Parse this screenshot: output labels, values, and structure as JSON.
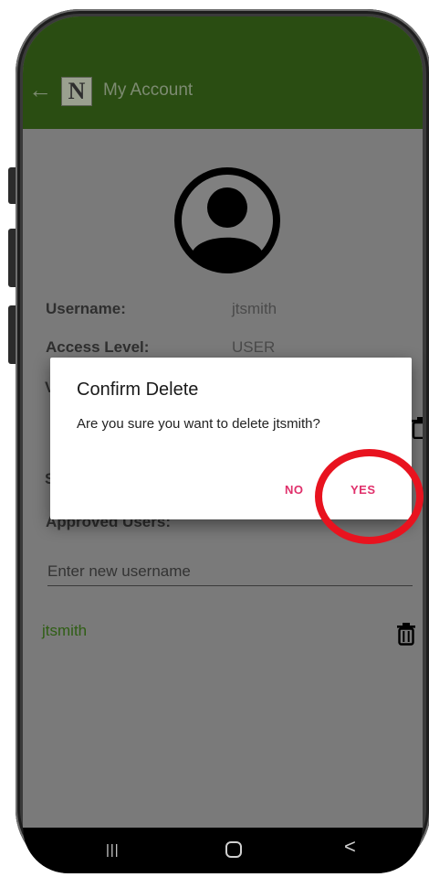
{
  "app_bar": {
    "back_icon": "back-arrow-icon",
    "logo_letter": "N",
    "title": "My Account",
    "color": "#2a4d12"
  },
  "profile": {
    "avatar_icon": "user-avatar-icon",
    "username_label": "Username:",
    "username_value": "jtsmith",
    "access_label": "Access Level:",
    "access_value": "USER",
    "partial_label_v": "V",
    "partial_label_s": "S"
  },
  "approved_users": {
    "heading": "Approved Users:",
    "input_placeholder": "Enter new username",
    "users": [
      {
        "name": "jtsmith",
        "delete_icon": "trash-icon"
      }
    ]
  },
  "dialog": {
    "title": "Confirm Delete",
    "message": "Are you sure you want to delete jtsmith?",
    "no_label": "NO",
    "yes_label": "YES",
    "button_color": "#e0306b"
  },
  "annotation": {
    "highlight_color": "#e8131f"
  },
  "nav_bar": {
    "recent_icon": "recent-apps-icon",
    "home_icon": "home-icon",
    "back_icon": "nav-back-icon",
    "recent_glyph": "|||",
    "back_glyph": "<"
  }
}
